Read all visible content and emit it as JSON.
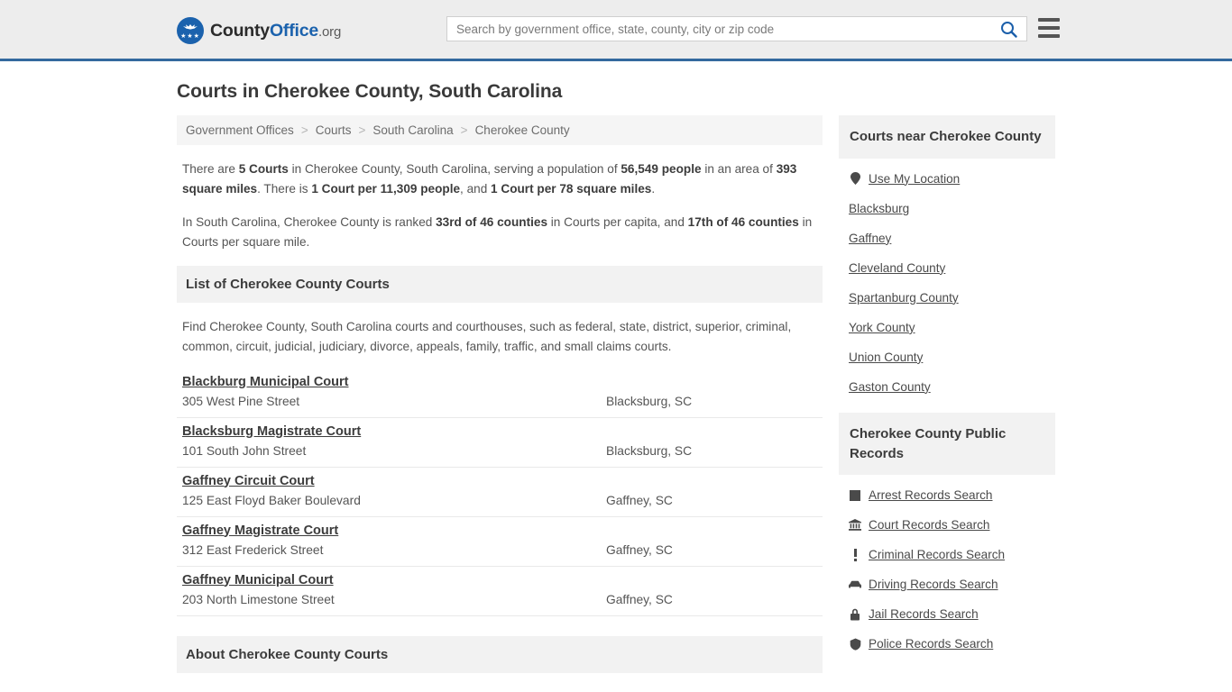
{
  "header": {
    "logo": {
      "text_part1": "County",
      "text_part2": "Office",
      "text_suffix": ".org",
      "icon": "eagle-seal-icon",
      "stars": "★★★",
      "brand_color": "#1b62ad"
    },
    "search": {
      "placeholder": "Search by government office, state, county, city or zip code",
      "value": "",
      "icon": "search-icon",
      "icon_color": "#1b5faa"
    },
    "menu": {
      "icon": "hamburger-menu-icon"
    },
    "accent_border_color": "#33699e",
    "background_color": "#ededed"
  },
  "main": {
    "title": "Courts in Cherokee County, South Carolina",
    "breadcrumb": {
      "separator": ">",
      "items": [
        "Government Offices",
        "Courts",
        "South Carolina",
        "Cherokee County"
      ]
    },
    "stats": {
      "p1_a": "There are ",
      "p1_b1": "5 Courts",
      "p1_c": " in Cherokee County, South Carolina, serving a population of ",
      "p1_b2": "56,549 people",
      "p1_d": " in an area of ",
      "p1_b3": "393 square miles",
      "p1_e": ". There is ",
      "p1_b4": "1 Court per 11,309 people",
      "p1_f": ", and ",
      "p1_b5": "1 Court per 78 square miles",
      "p1_g": ".",
      "p2_a": "In South Carolina, Cherokee County is ranked ",
      "p2_b1": "33rd of 46 counties",
      "p2_c": " in Courts per capita, and ",
      "p2_b2": "17th of 46 counties",
      "p2_d": " in Courts per square mile."
    },
    "list_section": {
      "heading": "List of Cherokee County Courts",
      "description": "Find Cherokee County, South Carolina courts and courthouses, such as federal, state, district, superior, criminal, common, circuit, judicial, judiciary, divorce, appeals, family, traffic, and small claims courts."
    },
    "courts": [
      {
        "name": "Blackburg Municipal Court",
        "address": "305 West Pine Street",
        "city": "Blacksburg, SC"
      },
      {
        "name": "Blacksburg Magistrate Court",
        "address": "101 South John Street",
        "city": "Blacksburg, SC"
      },
      {
        "name": "Gaffney Circuit Court",
        "address": "125 East Floyd Baker Boulevard",
        "city": "Gaffney, SC"
      },
      {
        "name": "Gaffney Magistrate Court",
        "address": "312 East Frederick Street",
        "city": "Gaffney, SC"
      },
      {
        "name": "Gaffney Municipal Court",
        "address": "203 North Limestone Street",
        "city": "Gaffney, SC"
      }
    ],
    "about_heading": "About Cherokee County Courts"
  },
  "sidebar": {
    "nearby": {
      "heading": "Courts near Cherokee County",
      "items": [
        {
          "label": "Use My Location",
          "icon": "map-pin-icon"
        },
        {
          "label": "Blacksburg",
          "icon": ""
        },
        {
          "label": "Gaffney",
          "icon": ""
        },
        {
          "label": "Cleveland County",
          "icon": ""
        },
        {
          "label": "Spartanburg County",
          "icon": ""
        },
        {
          "label": "York County",
          "icon": ""
        },
        {
          "label": "Union County",
          "icon": ""
        },
        {
          "label": "Gaston County",
          "icon": ""
        }
      ]
    },
    "public_records": {
      "heading": "Cherokee County Public Records",
      "items": [
        {
          "label": "Arrest Records Search",
          "icon": "fingerprint-square-icon"
        },
        {
          "label": "Court Records Search",
          "icon": "courthouse-icon"
        },
        {
          "label": "Criminal Records Search",
          "icon": "exclamation-icon"
        },
        {
          "label": "Driving Records Search",
          "icon": "car-icon"
        },
        {
          "label": "Jail Records Search",
          "icon": "lock-icon"
        },
        {
          "label": "Police Records Search",
          "icon": "police-badge-icon"
        }
      ]
    }
  }
}
